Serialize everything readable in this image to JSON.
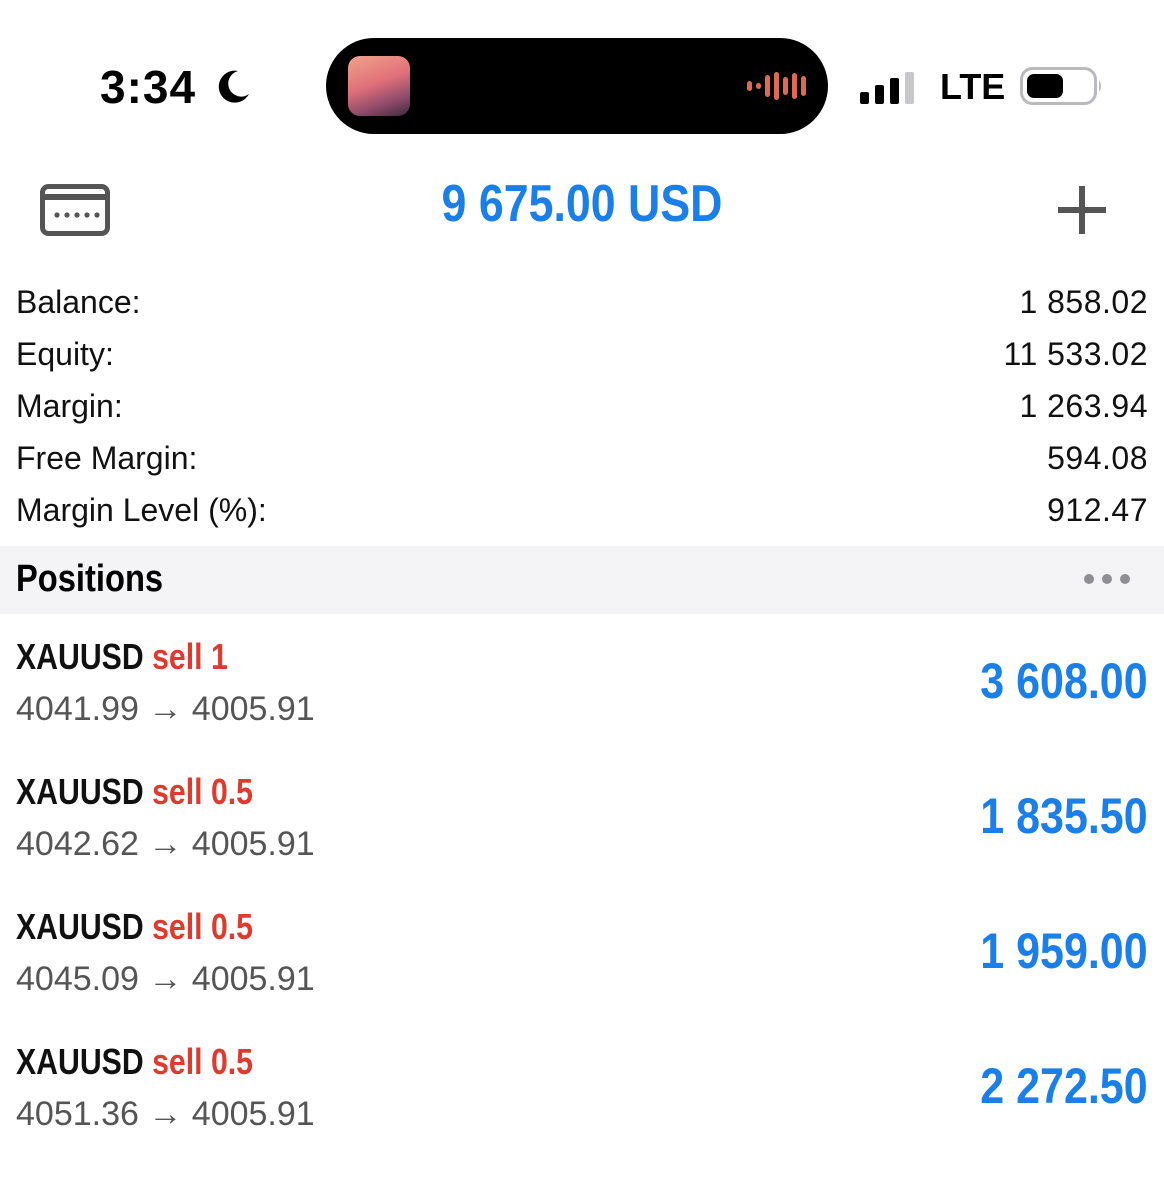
{
  "status_bar": {
    "time": "3:34",
    "network": "LTE",
    "icons": [
      "moon-icon",
      "signal-icon",
      "battery-icon",
      "audio-wave-icon"
    ]
  },
  "header": {
    "total": "9 675.00 USD",
    "left_icon": "card-icon",
    "right_icon": "plus-icon"
  },
  "summary": [
    {
      "label": "Balance:",
      "value": "1 858.02"
    },
    {
      "label": "Equity:",
      "value": "11 533.02"
    },
    {
      "label": "Margin:",
      "value": "1 263.94"
    },
    {
      "label": "Free Margin:",
      "value": "594.08"
    },
    {
      "label": "Margin Level (%):",
      "value": "912.47"
    }
  ],
  "positions": {
    "title": "Positions",
    "items": [
      {
        "symbol": "XAUUSD",
        "side": "sell 1",
        "prices": "4041.99 → 4005.91",
        "profit": "3 608.00"
      },
      {
        "symbol": "XAUUSD",
        "side": "sell 0.5",
        "prices": "4042.62 → 4005.91",
        "profit": "1 835.50"
      },
      {
        "symbol": "XAUUSD",
        "side": "sell 0.5",
        "prices": "4045.09 → 4005.91",
        "profit": "1 959.00"
      },
      {
        "symbol": "XAUUSD",
        "side": "sell 0.5",
        "prices": "4051.36 → 4005.91",
        "profit": "2 272.50"
      }
    ]
  },
  "colors": {
    "accent_blue": "#1a7fe8",
    "sell_red": "#e03a2f",
    "section_bg": "#f4f4f6"
  }
}
